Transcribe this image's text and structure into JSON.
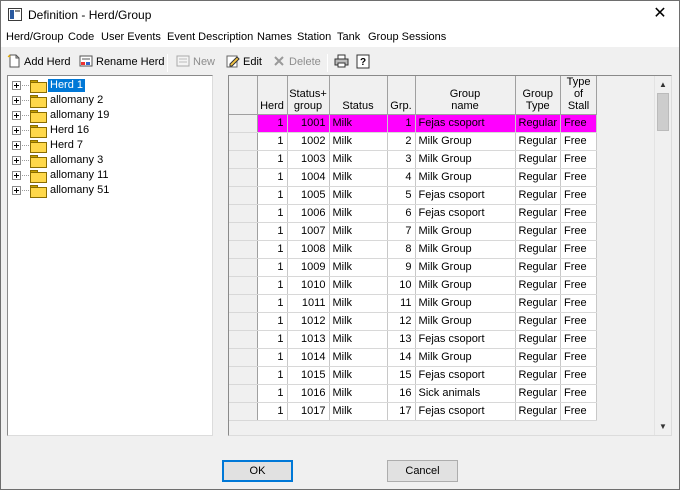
{
  "window": {
    "title": "Definition - Herd/Group",
    "close_glyph": "✕"
  },
  "menu": [
    "Herd/Group",
    "Code",
    "User Events",
    "Event Description",
    "Names",
    "Station",
    "Tank",
    "Group Sessions"
  ],
  "toolbar": {
    "add_herd": "Add Herd",
    "rename_herd": "Rename Herd",
    "new": "New",
    "edit": "Edit",
    "delete": "Delete",
    "print_icon": "printer-icon",
    "help_icon": "help-icon"
  },
  "tree": [
    {
      "label": "Herd 1",
      "selected": true
    },
    {
      "label": "allomany 2"
    },
    {
      "label": "allomany 19"
    },
    {
      "label": "Herd 16"
    },
    {
      "label": "Herd 7"
    },
    {
      "label": "allomany 3"
    },
    {
      "label": "allomany 11"
    },
    {
      "label": "allomany 51"
    }
  ],
  "grid": {
    "columns": [
      "Herd",
      "Status+\ngroup",
      "Status",
      "Grp.",
      "Group\nname",
      "Group\nType",
      "Type\nof Stall"
    ],
    "rows": [
      [
        "1",
        "1001",
        "Milk",
        "1",
        "Fejas csoport",
        "Regular",
        "Free"
      ],
      [
        "1",
        "1002",
        "Milk",
        "2",
        "Milk Group",
        "Regular",
        "Free"
      ],
      [
        "1",
        "1003",
        "Milk",
        "3",
        "Milk Group",
        "Regular",
        "Free"
      ],
      [
        "1",
        "1004",
        "Milk",
        "4",
        "Milk Group",
        "Regular",
        "Free"
      ],
      [
        "1",
        "1005",
        "Milk",
        "5",
        "Fejas csoport",
        "Regular",
        "Free"
      ],
      [
        "1",
        "1006",
        "Milk",
        "6",
        "Fejas csoport",
        "Regular",
        "Free"
      ],
      [
        "1",
        "1007",
        "Milk",
        "7",
        "Milk Group",
        "Regular",
        "Free"
      ],
      [
        "1",
        "1008",
        "Milk",
        "8",
        "Milk Group",
        "Regular",
        "Free"
      ],
      [
        "1",
        "1009",
        "Milk",
        "9",
        "Milk Group",
        "Regular",
        "Free"
      ],
      [
        "1",
        "1010",
        "Milk",
        "10",
        "Milk Group",
        "Regular",
        "Free"
      ],
      [
        "1",
        "1011",
        "Milk",
        "11",
        "Milk Group",
        "Regular",
        "Free"
      ],
      [
        "1",
        "1012",
        "Milk",
        "12",
        "Milk Group",
        "Regular",
        "Free"
      ],
      [
        "1",
        "1013",
        "Milk",
        "13",
        "Fejas csoport",
        "Regular",
        "Free"
      ],
      [
        "1",
        "1014",
        "Milk",
        "14",
        "Milk Group",
        "Regular",
        "Free"
      ],
      [
        "1",
        "1015",
        "Milk",
        "15",
        "Fejas csoport",
        "Regular",
        "Free"
      ],
      [
        "1",
        "1016",
        "Milk",
        "16",
        "Sick animals",
        "Regular",
        "Free"
      ],
      [
        "1",
        "1017",
        "Milk",
        "17",
        "Fejas csoport",
        "Regular",
        "Free"
      ]
    ],
    "selected_row": 0,
    "selected_color": "#ff00ff"
  },
  "buttons": {
    "ok": "OK",
    "cancel": "Cancel"
  }
}
